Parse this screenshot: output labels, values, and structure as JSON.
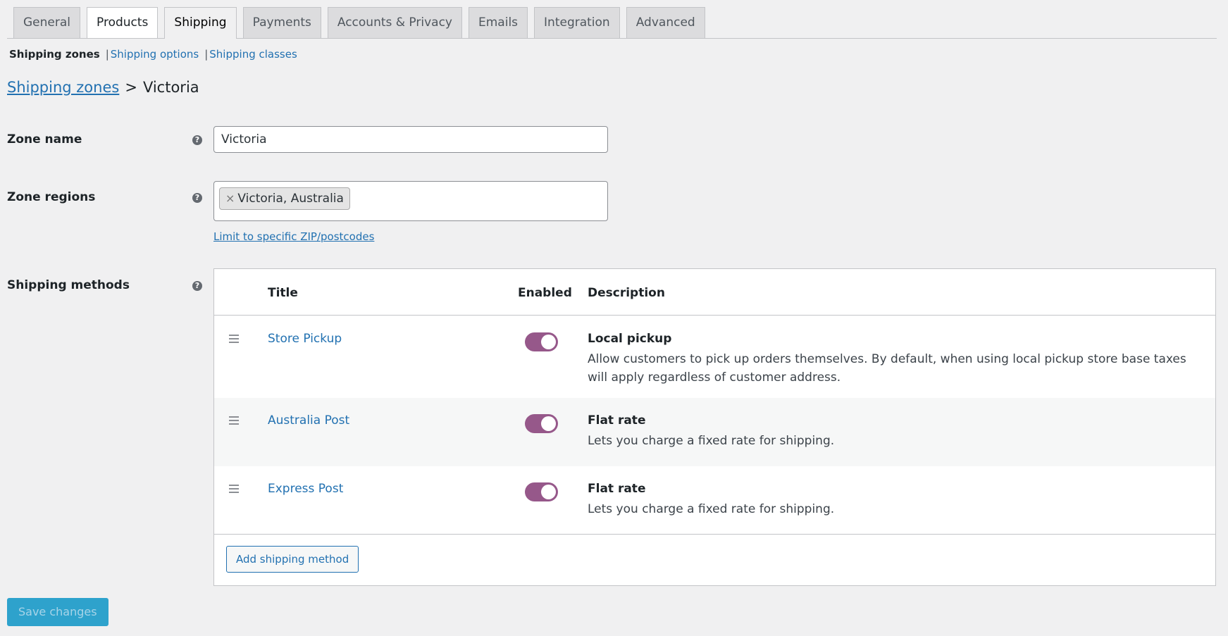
{
  "tabs": [
    "General",
    "Products",
    "Shipping",
    "Payments",
    "Accounts & Privacy",
    "Emails",
    "Integration",
    "Advanced"
  ],
  "active_tab": "Shipping",
  "subnav": {
    "current": "Shipping zones",
    "options": "Shipping options",
    "classes": "Shipping classes",
    "separator": "|"
  },
  "breadcrumb": {
    "link": "Shipping zones",
    "arrow": ">",
    "current": "Victoria"
  },
  "zone_name": {
    "label": "Zone name",
    "help_icon": "?",
    "value": "Victoria"
  },
  "zone_regions": {
    "label": "Zone regions",
    "help_icon": "?",
    "chip_remove": "×",
    "chip": "Victoria, Australia",
    "limit_link": "Limit to specific ZIP/postcodes"
  },
  "shipping_methods": {
    "label": "Shipping methods",
    "help_icon": "?",
    "headers": {
      "title": "Title",
      "enabled": "Enabled",
      "description": "Description"
    },
    "rows": [
      {
        "title": "Store Pickup",
        "enabled": true,
        "desc_title": "Local pickup",
        "desc_text": "Allow customers to pick up orders themselves. By default, when using local pickup store base taxes will apply regardless of customer address."
      },
      {
        "title": "Australia Post",
        "enabled": true,
        "desc_title": "Flat rate",
        "desc_text": "Lets you charge a fixed rate for shipping."
      },
      {
        "title": "Express Post",
        "enabled": true,
        "desc_title": "Flat rate",
        "desc_text": "Lets you charge a fixed rate for shipping."
      }
    ],
    "add_button": "Add shipping method"
  },
  "save_button": "Save changes",
  "colors": {
    "toggle_on": "#96588a",
    "link": "#2271b1",
    "save_button": "#2ea2cc"
  }
}
